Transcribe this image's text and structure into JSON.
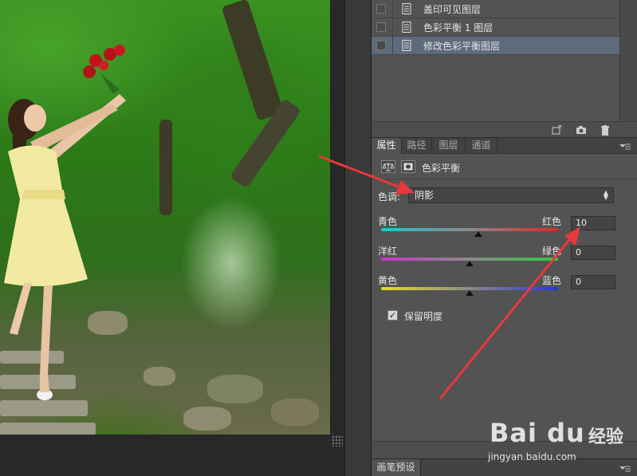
{
  "layers": [
    {
      "name": "盖印可见图层",
      "selected": false
    },
    {
      "name": "色彩平衡 1 图层",
      "selected": false
    },
    {
      "name": "修改色彩平衡图层",
      "selected": true
    }
  ],
  "properties": {
    "tabs": [
      "属性",
      "路径",
      "图层",
      "通道"
    ],
    "active_tab": "属性",
    "adjustment_title": "色彩平衡",
    "tone_label": "色调:",
    "tone_value": "阴影",
    "sliders": [
      {
        "left": "青色",
        "right": "红色",
        "value": "10",
        "level": 0.55
      },
      {
        "left": "洋红",
        "right": "绿色",
        "value": "0",
        "level": 0.5
      },
      {
        "left": "黄色",
        "right": "蓝色",
        "value": "0",
        "level": 0.5
      }
    ],
    "preserve_luminosity_label": "保留明度",
    "preserve_luminosity_checked": true,
    "check_glyph": "✓"
  },
  "brush_presets": {
    "label": "画笔预设"
  },
  "watermark": {
    "logo": "Bai du",
    "jingyan": "经验",
    "url": "jingyan.baidu.com"
  },
  "colors": {
    "panel_bg": "#535353",
    "selected_row": "#5e6b7c",
    "annotation_arrow": "#e8383d"
  }
}
